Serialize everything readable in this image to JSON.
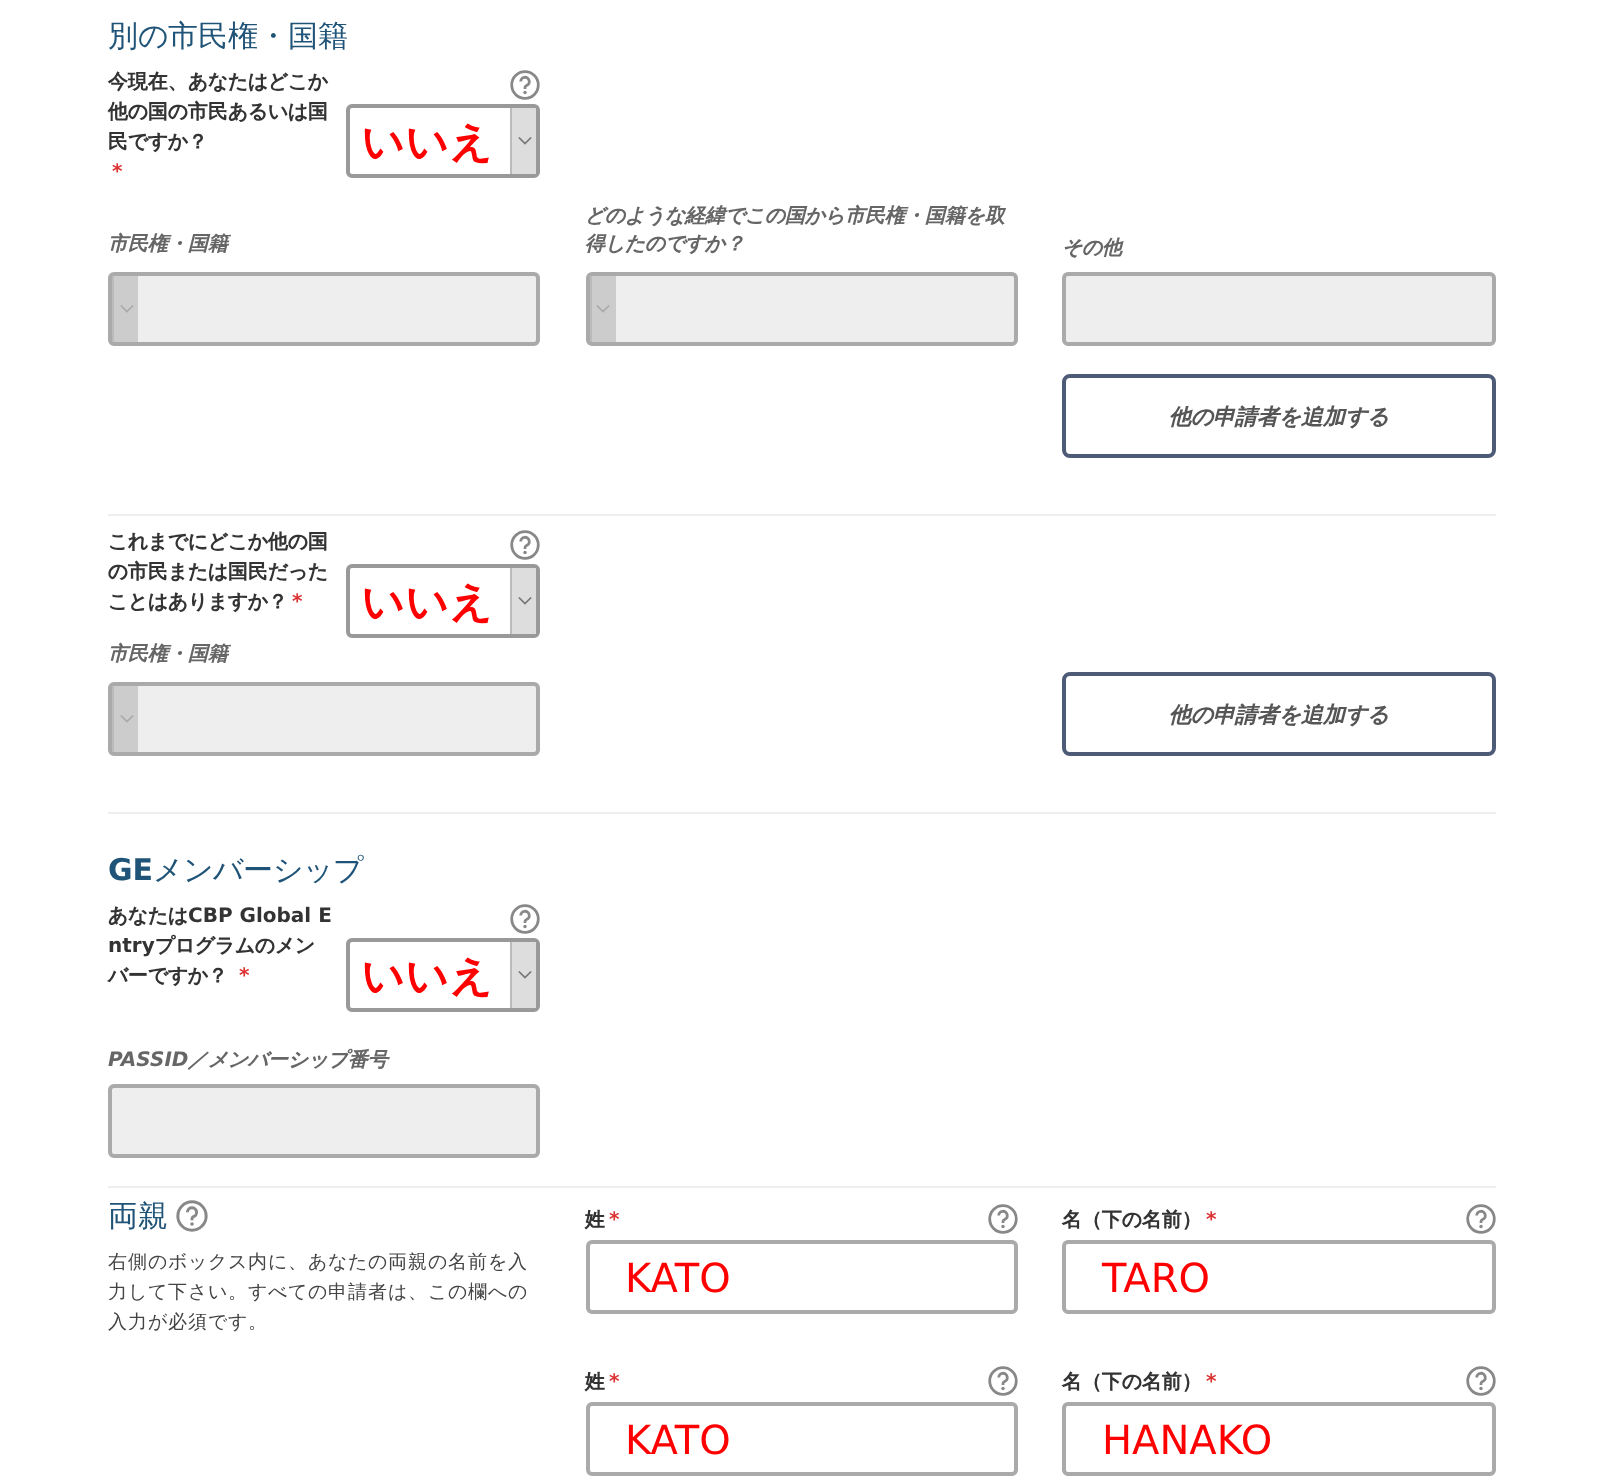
{
  "current_citizenship": {
    "title": "別の市民権・国籍",
    "question": "今現在、あなたはどこか他の国の市民あるいは国民ですか？",
    "required_mark": "*",
    "answer": "いいえ",
    "citizenship": {
      "label": "市民権・国籍",
      "disabled": true
    },
    "how_acquired": {
      "label": "どのような経緯でこの国から市民権・国籍を取得したのですか？",
      "disabled": true
    },
    "other": {
      "label": "その他",
      "disabled": true
    },
    "add_button": "他の申請者を追加する"
  },
  "former_citizenship": {
    "question": "これまでにどこか他の国の市民または国民だったことはありますか？",
    "required_mark": "*",
    "answer": "いいえ",
    "citizenship": {
      "label": "市民権・国籍",
      "disabled": true
    },
    "add_button": "他の申請者を追加する"
  },
  "ge_membership": {
    "title": "**GE**メンバーシップ",
    "question": "あなたはCBP Global Entryプログラムのメンバーですか？",
    "required_mark": "*",
    "answer": "いいえ",
    "passid": {
      "label": "PASSID／メンバーシップ番号",
      "disabled": true
    }
  },
  "parents": {
    "title": "両親",
    "description": "右側のボックス内に、あなたの両親の名前を入力して下さい。すべての申請者は、この欄への入力が必須です。",
    "rows": [
      {
        "surname": {
          "label": "姓",
          "required_mark": "*",
          "value": "KATO"
        },
        "given": {
          "label": "名（下の名前）",
          "required_mark": "*",
          "value": "TARO"
        }
      },
      {
        "surname": {
          "label": "姓",
          "required_mark": "*",
          "value": "KATO"
        },
        "given": {
          "label": "名（下の名前）",
          "required_mark": "*",
          "value": "HANAKO"
        }
      }
    ]
  }
}
